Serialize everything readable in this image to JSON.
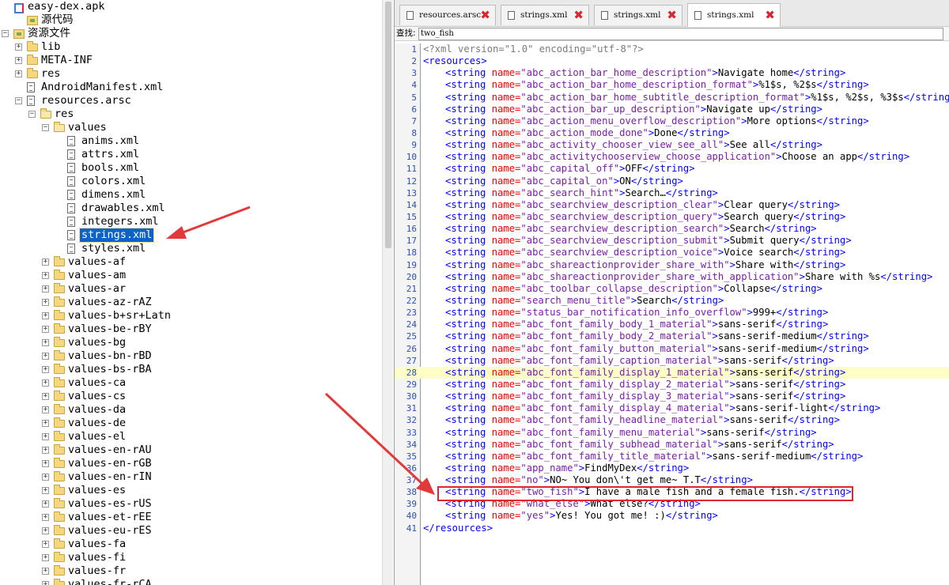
{
  "tree": {
    "items": [
      {
        "label": "easy-dex.apk",
        "icon": "apk-icon",
        "depth": 0,
        "toggle": "",
        "kind": "apk"
      },
      {
        "label": "源代码",
        "icon": "source-package-icon",
        "depth": 1,
        "toggle": "",
        "kind": "pkg"
      },
      {
        "label": "资源文件",
        "icon": "resources-package-icon",
        "depth": 0,
        "toggle": "-",
        "kind": "pkg"
      },
      {
        "label": "lib",
        "icon": "folder-icon",
        "depth": 1,
        "toggle": "+",
        "kind": "folder"
      },
      {
        "label": "META-INF",
        "icon": "folder-icon",
        "depth": 1,
        "toggle": "+",
        "kind": "folder"
      },
      {
        "label": "res",
        "icon": "folder-icon",
        "depth": 1,
        "toggle": "+",
        "kind": "folder"
      },
      {
        "label": "AndroidManifest.xml",
        "icon": "file-icon",
        "depth": 1,
        "toggle": "",
        "kind": "file"
      },
      {
        "label": "resources.arsc",
        "icon": "file-icon",
        "depth": 1,
        "toggle": "-",
        "kind": "file"
      },
      {
        "label": "res",
        "icon": "folder-open-icon",
        "depth": 2,
        "toggle": "-",
        "kind": "folder"
      },
      {
        "label": "values",
        "icon": "folder-open-icon",
        "depth": 3,
        "toggle": "-",
        "kind": "folder"
      },
      {
        "label": "anims.xml",
        "icon": "file-icon",
        "depth": 4,
        "toggle": "",
        "kind": "file"
      },
      {
        "label": "attrs.xml",
        "icon": "file-icon",
        "depth": 4,
        "toggle": "",
        "kind": "file"
      },
      {
        "label": "bools.xml",
        "icon": "file-icon",
        "depth": 4,
        "toggle": "",
        "kind": "file"
      },
      {
        "label": "colors.xml",
        "icon": "file-icon",
        "depth": 4,
        "toggle": "",
        "kind": "file"
      },
      {
        "label": "dimens.xml",
        "icon": "file-icon",
        "depth": 4,
        "toggle": "",
        "kind": "file"
      },
      {
        "label": "drawables.xml",
        "icon": "file-icon",
        "depth": 4,
        "toggle": "",
        "kind": "file"
      },
      {
        "label": "integers.xml",
        "icon": "file-icon",
        "depth": 4,
        "toggle": "",
        "kind": "file"
      },
      {
        "label": "strings.xml",
        "icon": "file-icon",
        "depth": 4,
        "toggle": "",
        "kind": "file",
        "selected": true
      },
      {
        "label": "styles.xml",
        "icon": "file-icon",
        "depth": 4,
        "toggle": "",
        "kind": "file"
      },
      {
        "label": "values-af",
        "icon": "folder-icon",
        "depth": 3,
        "toggle": "+",
        "kind": "folder"
      },
      {
        "label": "values-am",
        "icon": "folder-icon",
        "depth": 3,
        "toggle": "+",
        "kind": "folder"
      },
      {
        "label": "values-ar",
        "icon": "folder-icon",
        "depth": 3,
        "toggle": "+",
        "kind": "folder"
      },
      {
        "label": "values-az-rAZ",
        "icon": "folder-icon",
        "depth": 3,
        "toggle": "+",
        "kind": "folder"
      },
      {
        "label": "values-b+sr+Latn",
        "icon": "folder-icon",
        "depth": 3,
        "toggle": "+",
        "kind": "folder"
      },
      {
        "label": "values-be-rBY",
        "icon": "folder-icon",
        "depth": 3,
        "toggle": "+",
        "kind": "folder"
      },
      {
        "label": "values-bg",
        "icon": "folder-icon",
        "depth": 3,
        "toggle": "+",
        "kind": "folder"
      },
      {
        "label": "values-bn-rBD",
        "icon": "folder-icon",
        "depth": 3,
        "toggle": "+",
        "kind": "folder"
      },
      {
        "label": "values-bs-rBA",
        "icon": "folder-icon",
        "depth": 3,
        "toggle": "+",
        "kind": "folder"
      },
      {
        "label": "values-ca",
        "icon": "folder-icon",
        "depth": 3,
        "toggle": "+",
        "kind": "folder"
      },
      {
        "label": "values-cs",
        "icon": "folder-icon",
        "depth": 3,
        "toggle": "+",
        "kind": "folder"
      },
      {
        "label": "values-da",
        "icon": "folder-icon",
        "depth": 3,
        "toggle": "+",
        "kind": "folder"
      },
      {
        "label": "values-de",
        "icon": "folder-icon",
        "depth": 3,
        "toggle": "+",
        "kind": "folder"
      },
      {
        "label": "values-el",
        "icon": "folder-icon",
        "depth": 3,
        "toggle": "+",
        "kind": "folder"
      },
      {
        "label": "values-en-rAU",
        "icon": "folder-icon",
        "depth": 3,
        "toggle": "+",
        "kind": "folder"
      },
      {
        "label": "values-en-rGB",
        "icon": "folder-icon",
        "depth": 3,
        "toggle": "+",
        "kind": "folder"
      },
      {
        "label": "values-en-rIN",
        "icon": "folder-icon",
        "depth": 3,
        "toggle": "+",
        "kind": "folder"
      },
      {
        "label": "values-es",
        "icon": "folder-icon",
        "depth": 3,
        "toggle": "+",
        "kind": "folder"
      },
      {
        "label": "values-es-rUS",
        "icon": "folder-icon",
        "depth": 3,
        "toggle": "+",
        "kind": "folder"
      },
      {
        "label": "values-et-rEE",
        "icon": "folder-icon",
        "depth": 3,
        "toggle": "+",
        "kind": "folder"
      },
      {
        "label": "values-eu-rES",
        "icon": "folder-icon",
        "depth": 3,
        "toggle": "+",
        "kind": "folder"
      },
      {
        "label": "values-fa",
        "icon": "folder-icon",
        "depth": 3,
        "toggle": "+",
        "kind": "folder"
      },
      {
        "label": "values-fi",
        "icon": "folder-icon",
        "depth": 3,
        "toggle": "+",
        "kind": "folder"
      },
      {
        "label": "values-fr",
        "icon": "folder-icon",
        "depth": 3,
        "toggle": "+",
        "kind": "folder"
      },
      {
        "label": "values-fr-rCA",
        "icon": "folder-icon",
        "depth": 3,
        "toggle": "+",
        "kind": "folder"
      }
    ]
  },
  "tabs": [
    {
      "label": "resources.arsc",
      "active": false
    },
    {
      "label": "strings.xml",
      "active": false
    },
    {
      "label": "strings.xml",
      "active": false
    },
    {
      "label": "strings.xml",
      "active": true
    }
  ],
  "search": {
    "label": "查找:",
    "value": "two_fish"
  },
  "editor": {
    "header": "<?xml version=\"1.0\" encoding=\"utf-8\"?>",
    "root_open": "<resources>",
    "root_close": "</resources>",
    "highlight_line": 28,
    "boxed_line": 38,
    "strings": [
      {
        "name": "abc_action_bar_home_description",
        "value": "Navigate home"
      },
      {
        "name": "abc_action_bar_home_description_format",
        "value": "%1$s, %2$s"
      },
      {
        "name": "abc_action_bar_home_subtitle_description_format",
        "value": "%1$s, %2$s, %3$s"
      },
      {
        "name": "abc_action_bar_up_description",
        "value": "Navigate up"
      },
      {
        "name": "abc_action_menu_overflow_description",
        "value": "More options"
      },
      {
        "name": "abc_action_mode_done",
        "value": "Done"
      },
      {
        "name": "abc_activity_chooser_view_see_all",
        "value": "See all"
      },
      {
        "name": "abc_activitychooserview_choose_application",
        "value": "Choose an app"
      },
      {
        "name": "abc_capital_off",
        "value": "OFF"
      },
      {
        "name": "abc_capital_on",
        "value": "ON"
      },
      {
        "name": "abc_search_hint",
        "value": "Search…"
      },
      {
        "name": "abc_searchview_description_clear",
        "value": "Clear query"
      },
      {
        "name": "abc_searchview_description_query",
        "value": "Search query"
      },
      {
        "name": "abc_searchview_description_search",
        "value": "Search"
      },
      {
        "name": "abc_searchview_description_submit",
        "value": "Submit query"
      },
      {
        "name": "abc_searchview_description_voice",
        "value": "Voice search"
      },
      {
        "name": "abc_shareactionprovider_share_with",
        "value": "Share with"
      },
      {
        "name": "abc_shareactionprovider_share_with_application",
        "value": "Share with %s"
      },
      {
        "name": "abc_toolbar_collapse_description",
        "value": "Collapse"
      },
      {
        "name": "search_menu_title",
        "value": "Search"
      },
      {
        "name": "status_bar_notification_info_overflow",
        "value": "999+"
      },
      {
        "name": "abc_font_family_body_1_material",
        "value": "sans-serif"
      },
      {
        "name": "abc_font_family_body_2_material",
        "value": "sans-serif-medium"
      },
      {
        "name": "abc_font_family_button_material",
        "value": "sans-serif-medium"
      },
      {
        "name": "abc_font_family_caption_material",
        "value": "sans-serif"
      },
      {
        "name": "abc_font_family_display_1_material",
        "value": "sans-serif"
      },
      {
        "name": "abc_font_family_display_2_material",
        "value": "sans-serif"
      },
      {
        "name": "abc_font_family_display_3_material",
        "value": "sans-serif"
      },
      {
        "name": "abc_font_family_display_4_material",
        "value": "sans-serif-light"
      },
      {
        "name": "abc_font_family_headline_material",
        "value": "sans-serif"
      },
      {
        "name": "abc_font_family_menu_material",
        "value": "sans-serif"
      },
      {
        "name": "abc_font_family_subhead_material",
        "value": "sans-serif"
      },
      {
        "name": "abc_font_family_title_material",
        "value": "sans-serif-medium"
      },
      {
        "name": "app_name",
        "value": "FindMyDex"
      },
      {
        "name": "no",
        "value": "NO~ You don\\'t get me~ T.T"
      },
      {
        "name": "two_fish",
        "value": "I have a male fish and a female fish."
      },
      {
        "name": "what_else",
        "value": "What else?"
      },
      {
        "name": "yes",
        "value": "Yes! You got me! :)"
      }
    ]
  },
  "colors": {
    "tag": "#0000ff",
    "attr": "#ff0000",
    "value": "#7a1ea8",
    "line_number": "#2b50b6",
    "highlight_row": "#fdfdc8",
    "callout": "#e0262f",
    "selection": "#0a63c9"
  }
}
